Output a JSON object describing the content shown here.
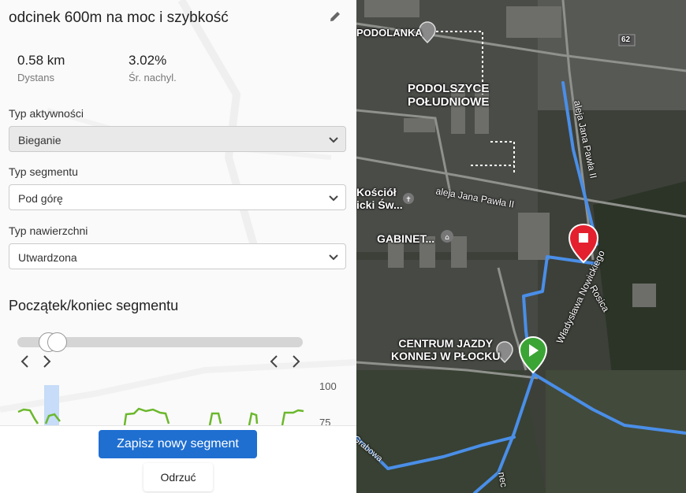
{
  "segment": {
    "title": "odcinek 600m na moc i szybkość",
    "distance_value": "0.58 km",
    "distance_label": "Dystans",
    "grade_value": "3.02%",
    "grade_label": "Śr. nachyl."
  },
  "activity": {
    "label": "Typ aktywności",
    "value": "Bieganie"
  },
  "segment_type": {
    "label": "Typ segmentu",
    "value": "Pod górę"
  },
  "surface": {
    "label": "Typ nawierzchni",
    "value": "Utwardzona"
  },
  "range": {
    "title": "Początek/koniec segmentu",
    "start_fraction": 0.11,
    "end_fraction": 0.14
  },
  "profile": {
    "axis_top": "100",
    "axis_bottom": "75"
  },
  "buttons": {
    "save": "Zapisz nowy segment",
    "discard": "Odrzuć"
  },
  "map": {
    "labels": {
      "podolanka": "PODOLANKA",
      "district": "PODOLSZYCE\nPOŁUDNIOWE",
      "church": "Kościół\nicki Św...",
      "clinic": "GABINET...",
      "riding": "CENTRUM JAZDY\nKONNEJ W PŁOCKU",
      "road_number": "62",
      "street_jp2_a": "aleja Jana Pawła II",
      "street_jp2_b": "aleja Jana Pawła II",
      "street_nowicki": "Władysława Nowickiego",
      "river": "Rosica",
      "street_bottom": "nec",
      "street_left": "Grabowa"
    },
    "colors": {
      "route": "#4a8ee8",
      "start": "#3aa535",
      "end": "#e4202e"
    }
  }
}
